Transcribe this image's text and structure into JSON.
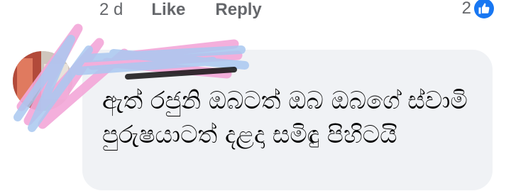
{
  "actions": {
    "timestamp": "2 d",
    "like_label": "Like",
    "reply_label": "Reply"
  },
  "reactions": {
    "count": "2",
    "icon": "thumbs-up-icon",
    "color": "#1877f2"
  },
  "comment": {
    "text": "ඇත් රජුනි ඔබටත් ඔබ ඔබගේ ස්වාමි පුරුෂයාටත් දළදා සමිඳු පිහිටයි"
  },
  "colors": {
    "bubble": "#f0f2f5",
    "meta_text": "#65676b",
    "redaction_pink": "#f3a6d8",
    "redaction_blue": "#a9c8f0"
  }
}
